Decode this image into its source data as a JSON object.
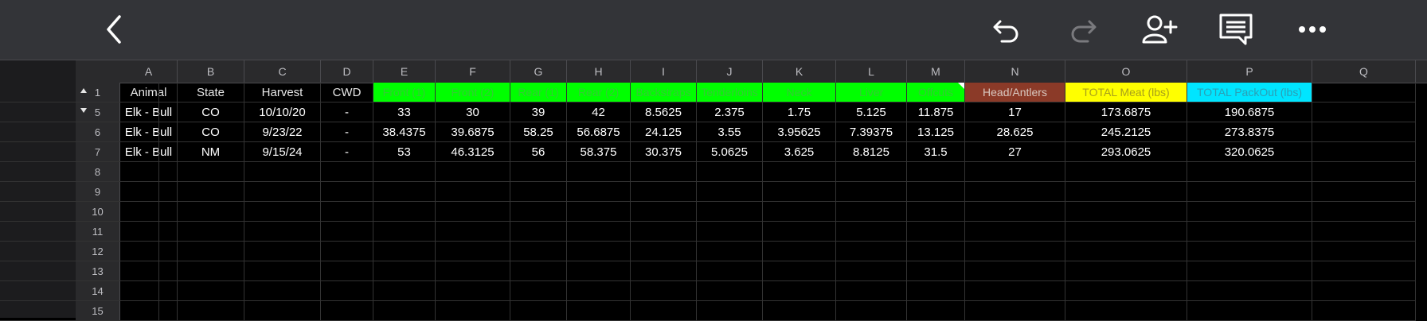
{
  "toolbar": {
    "icons": [
      "back-chevron-icon",
      "undo-icon",
      "redo-icon",
      "add-user-icon",
      "comment-icon",
      "more-icon"
    ],
    "redo_disabled": true
  },
  "sheet": {
    "columns": [
      "A",
      "B",
      "C",
      "D",
      "E",
      "F",
      "G",
      "H",
      "I",
      "J",
      "K",
      "L",
      "M",
      "N",
      "O",
      "P",
      "Q"
    ],
    "header_row": {
      "row_number": "1",
      "cells": [
        "Animal",
        "State",
        "Harvest",
        "CWD",
        "Front (1)",
        "Front (2)",
        "Rear (1)",
        "Rear (2)",
        "Backstraps",
        "Tenderloins",
        "Neck",
        "Liver",
        "Offcuts",
        "Head/Antlers",
        "TOTAL Meat (lbs)",
        "TOTAL PackOut (lbs)",
        ""
      ],
      "colors": {
        "green": "#00ff00",
        "brown": "#8b3a28",
        "yellow": "#ffff00",
        "cyan": "#00e5ff"
      }
    },
    "data_rows": [
      {
        "row_number": "5",
        "cells": [
          "Elk - Bull",
          "CO",
          "10/10/20",
          "-",
          "33",
          "30",
          "39",
          "42",
          "8.5625",
          "2.375",
          "1.75",
          "5.125",
          "11.875",
          "17",
          "173.6875",
          "190.6875",
          ""
        ]
      },
      {
        "row_number": "6",
        "cells": [
          "Elk - Bull",
          "CO",
          "9/23/22",
          "-",
          "38.4375",
          "39.6875",
          "58.25",
          "56.6875",
          "24.125",
          "3.55",
          "3.95625",
          "7.39375",
          "13.125",
          "28.625",
          "245.2125",
          "273.8375",
          ""
        ]
      },
      {
        "row_number": "7",
        "cells": [
          "Elk - Bull",
          "NM",
          "9/15/24",
          "-",
          "53",
          "46.3125",
          "56",
          "58.375",
          "30.375",
          "5.0625",
          "3.625",
          "8.8125",
          "31.5",
          "27",
          "293.0625",
          "320.0625",
          ""
        ]
      }
    ],
    "empty_rows": [
      "8",
      "9",
      "10",
      "11",
      "12",
      "13",
      "14",
      "15"
    ]
  }
}
